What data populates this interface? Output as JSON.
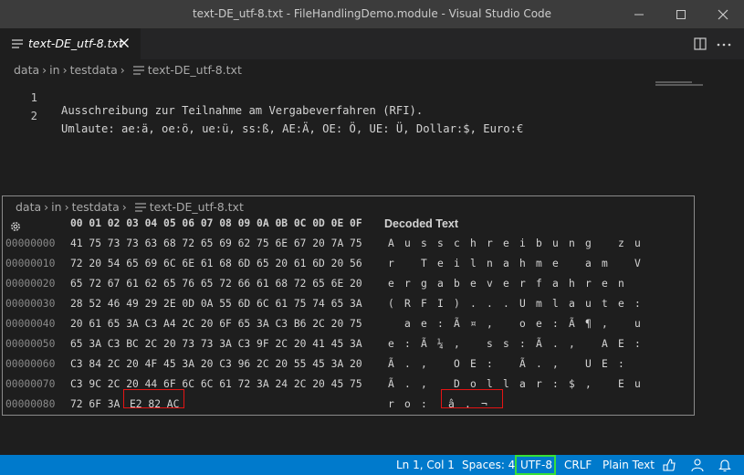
{
  "window": {
    "title": "text-DE_utf-8.txt - FileHandlingDemo.module - Visual Studio Code"
  },
  "tab": {
    "label": "text-DE_utf-8.txt"
  },
  "breadcrumb": [
    "data",
    "in",
    "testdata",
    "text-DE_utf-8.txt"
  ],
  "editor": {
    "lines": [
      {
        "num": "1",
        "text": "Ausschreibung zur Teilnahme am Vergabeverfahren (RFI)."
      },
      {
        "num": "2",
        "text": "Umlaute: ae:ä, oe:ö, ue:ü, ss:ß, AE:Ä, OE: Ö, UE: Ü, Dollar:$, Euro:€"
      }
    ]
  },
  "hex_editor": {
    "breadcrumb": [
      "data",
      "in",
      "testdata",
      "text-DE_utf-8.txt"
    ],
    "header_bytes": "00 01 02 03 04 05 06 07 08 09 0A 0B 0C 0D 0E 0F",
    "decoded_title": "Decoded Text",
    "rows": [
      {
        "offset": "00000000",
        "bytes": "41 75 73 73 63 68 72 65 69 62 75 6E 67 20 7A 75",
        "decoded": "Ausschreibung zu"
      },
      {
        "offset": "00000010",
        "bytes": "72 20 54 65 69 6C 6E 61 68 6D 65 20 61 6D 20 56",
        "decoded": "r Teilnahme am V"
      },
      {
        "offset": "00000020",
        "bytes": "65 72 67 61 62 65 76 65 72 66 61 68 72 65 6E 20",
        "decoded": "ergabeverfahren "
      },
      {
        "offset": "00000030",
        "bytes": "28 52 46 49 29 2E 0D 0A 55 6D 6C 61 75 74 65 3A",
        "decoded": "(RFI)...Umlaute:"
      },
      {
        "offset": "00000040",
        "bytes": "20 61 65 3A C3 A4 2C 20 6F 65 3A C3 B6 2C 20 75",
        "decoded": " ae:Ã¤, oe:Ã¶, u"
      },
      {
        "offset": "00000050",
        "bytes": "65 3A C3 BC 2C 20 73 73 3A C3 9F 2C 20 41 45 3A",
        "decoded": "e:Ã¼, ss:Ã., AE:"
      },
      {
        "offset": "00000060",
        "bytes": "C3 84 2C 20 4F 45 3A 20 C3 96 2C 20 55 45 3A 20",
        "decoded": "Ã., OE: Ã., UE: "
      },
      {
        "offset": "00000070",
        "bytes": "C3 9C 2C 20 44 6F 6C 6C 61 72 3A 24 2C 20 45 75",
        "decoded": "Ã., Dollar:$, Eu"
      },
      {
        "offset": "00000080",
        "bytes_plain": "72 6F 3A",
        "bytes_highlight": "E2 82 AC",
        "decoded_plain": "ro:",
        "decoded_highlight": "â.¬"
      }
    ]
  },
  "status_bar": {
    "position": "Ln 1, Col 1",
    "spaces": "Spaces: 4",
    "encoding": "UTF-8",
    "eol": "CRLF",
    "language": "Plain Text"
  },
  "colors": {
    "status_bar": "#007acc",
    "highlight_box": "#e51414",
    "encoding_box": "#37e037"
  }
}
